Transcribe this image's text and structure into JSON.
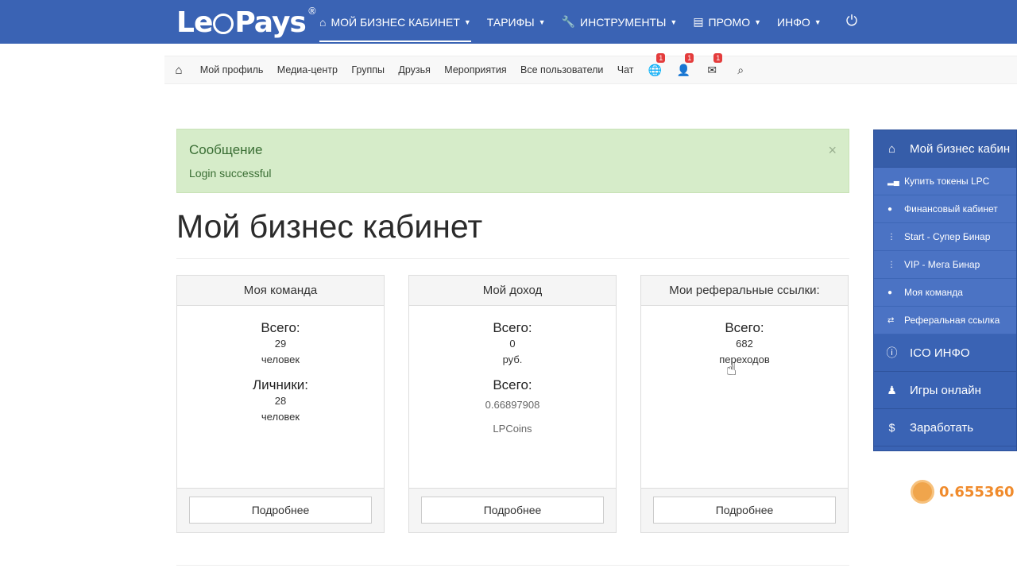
{
  "logo": {
    "left": "Le",
    "right": "Pays",
    "reg": "®"
  },
  "topnav": [
    {
      "icon": "home-icon",
      "label": "МОЙ БИЗНЕС КАБИНЕТ",
      "active": true
    },
    {
      "icon": "",
      "label": "ТАРИФЫ",
      "active": false
    },
    {
      "icon": "wrench-icon",
      "label": "ИНСТРУМЕНТЫ",
      "active": false
    },
    {
      "icon": "list-icon",
      "label": "ПРОМО",
      "active": false
    },
    {
      "icon": "",
      "label": "ИНФО",
      "active": false
    }
  ],
  "subnav": {
    "links": [
      "Мой профиль",
      "Медиа-центр",
      "Группы",
      "Друзья",
      "Мероприятия",
      "Все пользователи",
      "Чат"
    ],
    "notifications": [
      {
        "icon": "globe-icon",
        "count": "1"
      },
      {
        "icon": "user-icon",
        "count": "1"
      },
      {
        "icon": "envelope-icon",
        "count": "1"
      }
    ]
  },
  "alert": {
    "title": "Сообщение",
    "message": "Login successful",
    "close": "×"
  },
  "page_title": "Мой бизнес кабинет",
  "cards": {
    "team": {
      "header": "Моя команда",
      "total_label": "Всего:",
      "total_value": "29",
      "total_unit": "человек",
      "personal_label": "Личники:",
      "personal_value": "28",
      "personal_unit": "человек",
      "button": "Подробнее"
    },
    "income": {
      "header": "Мой доход",
      "total_label": "Всего:",
      "total_value": "0",
      "total_unit": "руб.",
      "coins_label": "Всего:",
      "coins_value": "0.66897908",
      "coins_unit": "LPCoins",
      "button": "Подробнее"
    },
    "referral": {
      "header": "Мои реферальные ссылки:",
      "total_label": "Всего:",
      "total_value": "682",
      "total_unit": "переходов",
      "button": "Подробнее"
    }
  },
  "sidemenu": {
    "main": "Мой бизнес кабин",
    "sub": [
      "Купить токены LPC",
      "Финансовый кабинет",
      "Start - Супер Бинар",
      "VIP - Мега Бинар",
      "Моя команда",
      "Реферальная ссылка"
    ],
    "categories": [
      "ICO ИНФО",
      "Игры онлайн",
      "Заработать"
    ]
  },
  "coin_balance": "0.655360"
}
